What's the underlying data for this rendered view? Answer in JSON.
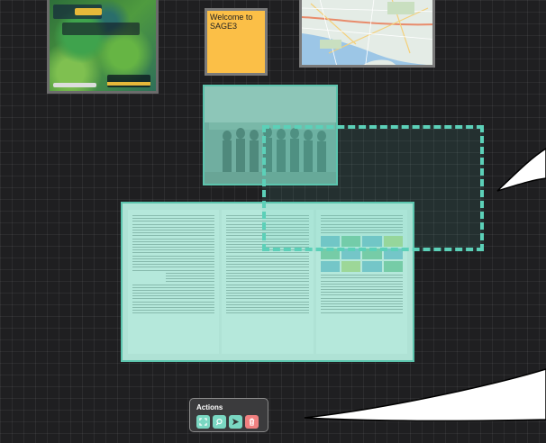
{
  "sticky_note": {
    "text": "Welcome to\nSAGE3"
  },
  "actions_panel": {
    "title": "Actions",
    "buttons": [
      "expand-icon",
      "search-icon",
      "send-icon",
      "trash-icon"
    ]
  },
  "colors": {
    "selection": "#5cd0b8",
    "sticky": "#fbbf47",
    "delete": "#f08080"
  }
}
